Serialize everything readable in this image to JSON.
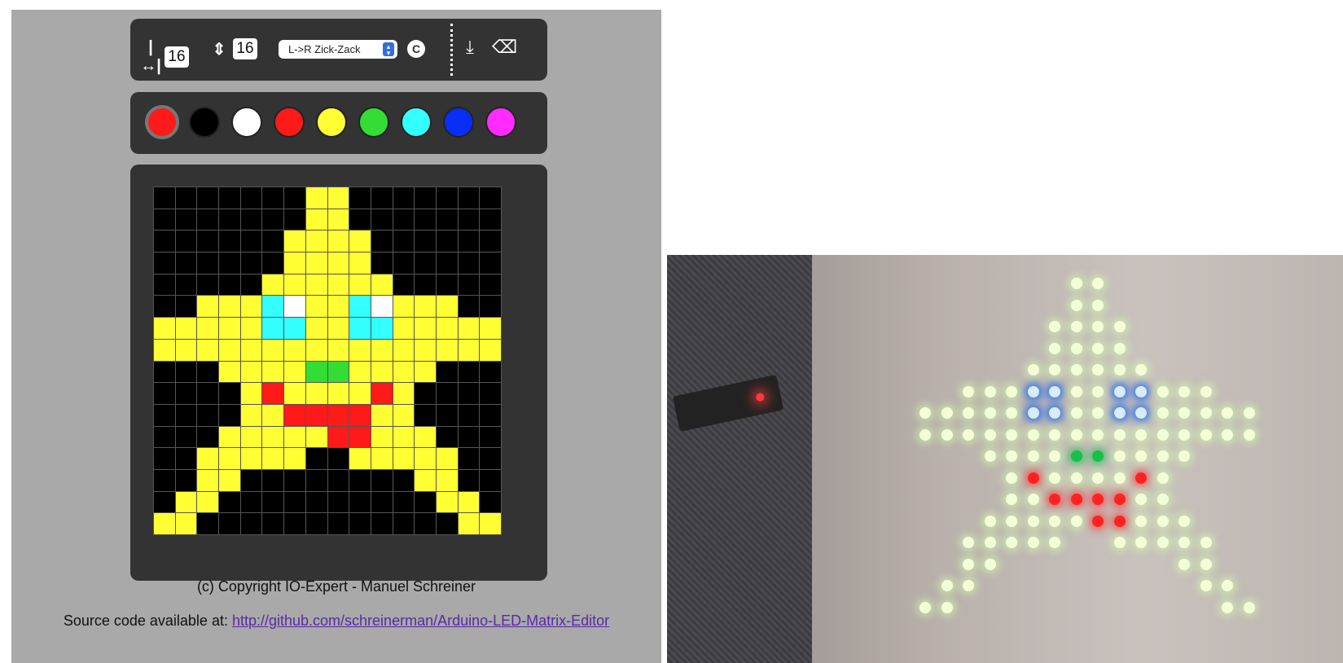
{
  "toolbar": {
    "width_icon": "width-icon",
    "width_value": "16",
    "height_icon": "height-icon",
    "height_value": "16",
    "mode_select": "L->R Zick-Zack",
    "copyright_button_icon": "copyright-c-icon",
    "download_icon": "download-icon",
    "eraser_icon": "eraser-icon"
  },
  "palette": {
    "current": "#ff1a1a",
    "colors": [
      "#000000",
      "#ffffff",
      "#ff1a1a",
      "#ffff33",
      "#33dd33",
      "#33ffff",
      "#0a2ef5",
      "#ff2bff"
    ]
  },
  "matrix": {
    "size": 16,
    "colors": {
      "K": "#000000",
      "Y": "#ffff33",
      "C": "#33ffff",
      "W": "#ffffff",
      "G": "#33dd33",
      "R": "#ff1a1a"
    },
    "rows": [
      "KKKKKKKYYKKKKKKK",
      "KKKKKKKYYKKKKKKK",
      "KKKKKKYYYYKKKKKK",
      "KKKKKKYYYYKKKKKK",
      "KKKKKYYYYYYKKKKK",
      "KKYYYCWYYCWYYYKK",
      "YYYYYCCYYCCYYYYY",
      "YYYYYYYYYYYYYYYY",
      "KKKYYYYGGYYYYKKK",
      "KKKKYRYYYYRYKKKK",
      "KKKKYYRRRRYYKKKK",
      "KKKYYYYYRRYYYKKK",
      "KKYYYYYKKYYYYYKK",
      "KKYYKKKKKKKKYYKK",
      "KYYKKKKKKKKKKYYK",
      "YYKKKKKKKKKKKKYY"
    ]
  },
  "footer": {
    "copyright": "(c) Copyright IO-Expert - Manuel Schreiner",
    "source_prefix": "Source code available at: ",
    "source_link": "http://github.com/schreinerman/Arduino-LED-Matrix-Editor"
  },
  "photo": {
    "led_on": "#f4ffd8",
    "eye": "#d8ecff",
    "mouth": "#ff2222",
    "nose": "#18c04a"
  }
}
